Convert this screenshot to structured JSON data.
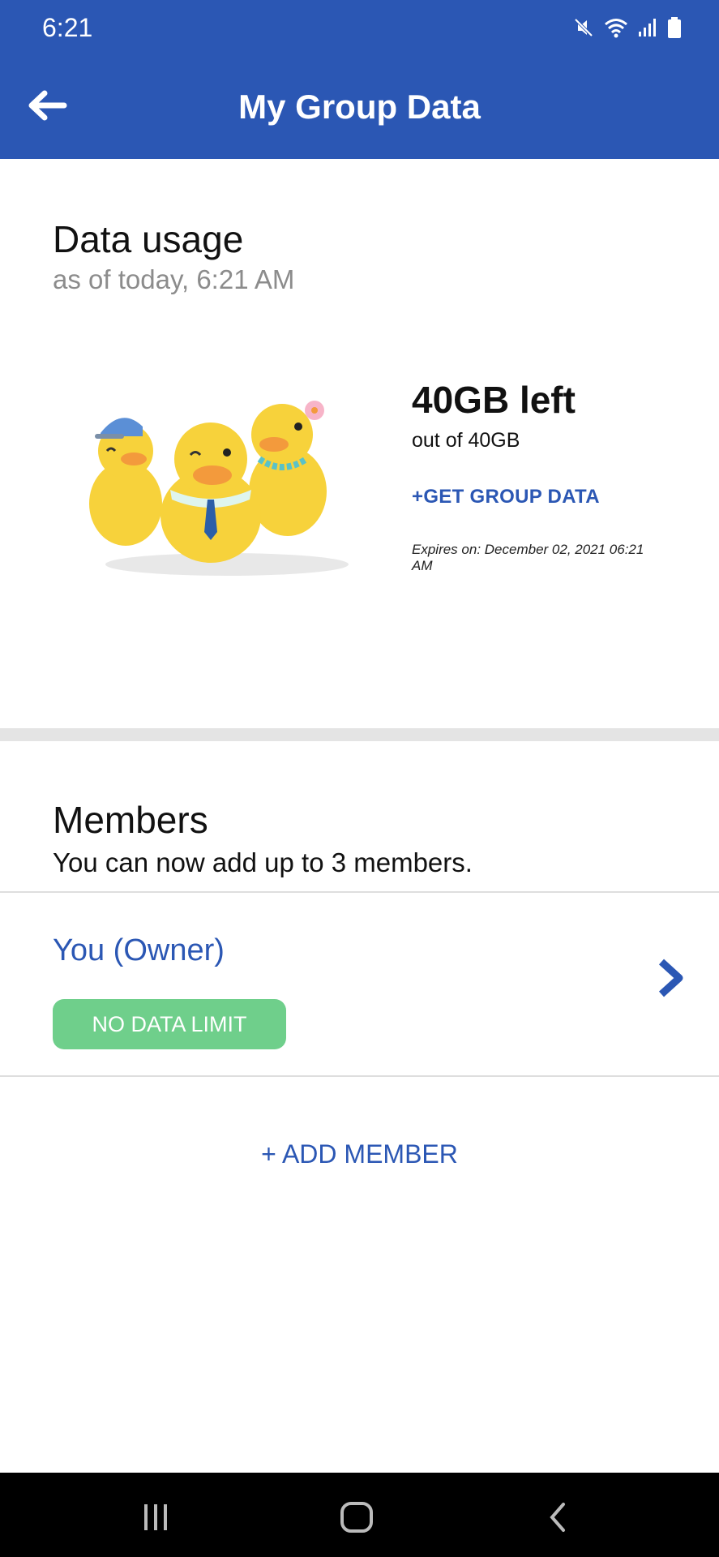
{
  "status_bar": {
    "time": "6:21",
    "icons": [
      "mute-icon",
      "wifi-icon",
      "signal-icon",
      "battery-icon"
    ]
  },
  "app_bar": {
    "back_icon": "back-arrow-icon",
    "title": "My Group Data"
  },
  "data_usage": {
    "title": "Data usage",
    "as_of": "as of today, 6:21 AM",
    "remaining": "40GB left",
    "total": "out of 40GB",
    "get_more_label": "+GET GROUP DATA",
    "expires": "Expires on: December 02, 2021 06:21 AM"
  },
  "members": {
    "title": "Members",
    "subtitle": "You can now add up to 3 members.",
    "items": [
      {
        "name": "You (Owner)",
        "badge": "NO DATA LIMIT"
      }
    ],
    "add_label": "+ ADD MEMBER"
  },
  "nav_bar": {
    "icons": [
      "recent-apps-icon",
      "home-icon",
      "back-icon"
    ]
  },
  "colors": {
    "brand": "#2b57b4",
    "badge": "#6fcf8b",
    "divider": "#e4e4e4"
  }
}
